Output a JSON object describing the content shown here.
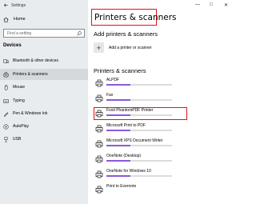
{
  "window": {
    "title": "Settings",
    "controls": [
      "—",
      "□",
      "✕"
    ]
  },
  "sidebar": {
    "home_label": "Home",
    "search_placeholder": "Find a setting",
    "section_header": "Devices",
    "items": [
      {
        "label": "Bluetooth & other devices",
        "icon": "bluetooth-icon"
      },
      {
        "label": "Printers & scanners",
        "icon": "printer-icon",
        "active": true
      },
      {
        "label": "Mouse",
        "icon": "mouse-icon"
      },
      {
        "label": "Typing",
        "icon": "keyboard-icon"
      },
      {
        "label": "Pen & Windows Ink",
        "icon": "pen-icon"
      },
      {
        "label": "AutoPlay",
        "icon": "autoplay-icon"
      },
      {
        "label": "USB",
        "icon": "usb-icon"
      }
    ]
  },
  "main": {
    "page_title": "Printers & scanners",
    "add_section_title": "Add printers & scanners",
    "add_label": "Add a printer or scanner",
    "list_section_title": "Printers & scanners",
    "printers": [
      {
        "name": "ALPDF",
        "fill": 0.36
      },
      {
        "name": "Fax",
        "fill": 0.36
      },
      {
        "name": "Foxit PhantomPDF Printer",
        "fill": 0.36
      },
      {
        "name": "Microsoft Print to PDF",
        "fill": 0.36
      },
      {
        "name": "Microsoft XPS Document Writer",
        "fill": 0.36
      },
      {
        "name": "OneNote (Desktop)",
        "fill": 0.36
      },
      {
        "name": "OneNote for Windows 10",
        "fill": 0.36
      },
      {
        "name": "Print to Evernote",
        "fill": 0
      }
    ]
  },
  "colors": {
    "accent": "#8a5ad8",
    "highlight": "#e01515",
    "sidebar_bg": "#e8ecef"
  }
}
